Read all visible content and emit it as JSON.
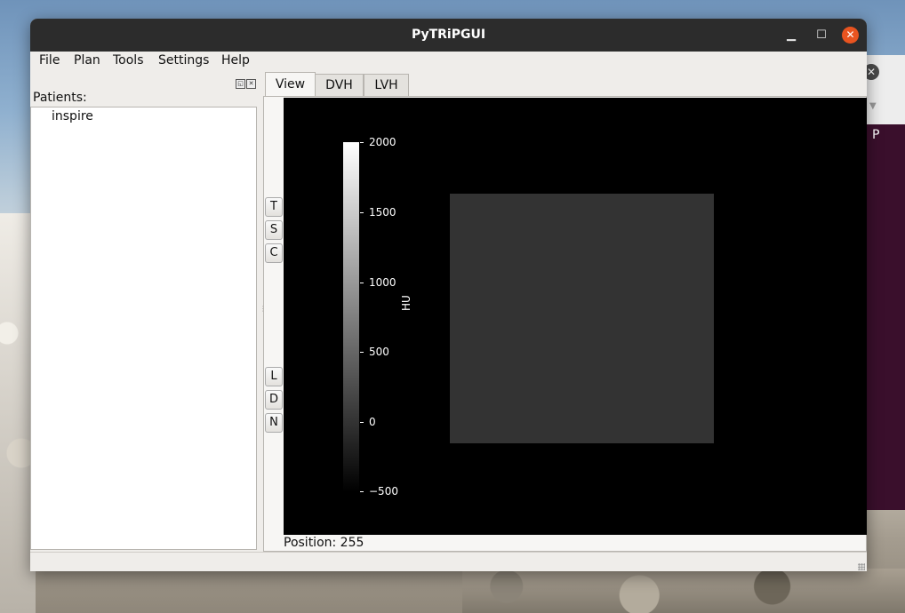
{
  "window": {
    "title": "PyTRiPGUI"
  },
  "menubar": {
    "items": [
      "File",
      "Plan",
      "Tools",
      "Settings",
      "Help"
    ]
  },
  "dock": {
    "patients_label": "Patients:",
    "patients": [
      "inspire"
    ]
  },
  "tabs": [
    "View",
    "DVH",
    "LVH"
  ],
  "active_tab": "View",
  "view_buttons": {
    "top": [
      "T",
      "S",
      "C"
    ],
    "bottom": [
      "L",
      "D",
      "N"
    ]
  },
  "colorbar": {
    "label": "HU",
    "ticks": [
      "2000",
      "1500",
      "1000",
      "500",
      "0",
      "−500"
    ],
    "range": [
      -500,
      2000
    ]
  },
  "status": {
    "position": "Position: 255"
  },
  "background_window": {
    "letter": "P"
  },
  "colors": {
    "close_button": "#e95420",
    "canvas": "#000000",
    "image_square": "#333333"
  }
}
